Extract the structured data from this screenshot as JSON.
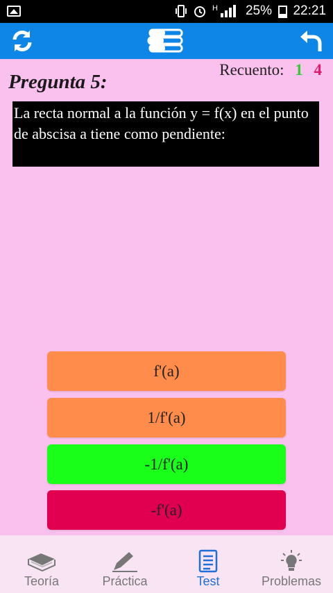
{
  "status_bar": {
    "battery_percent": "25%",
    "time": "22:21",
    "network_type": "H",
    "icons": [
      "image-icon",
      "vibrate-icon",
      "alarm-icon",
      "signal-icon",
      "battery-icon"
    ]
  },
  "toolbar": {
    "background": "#0d86e8",
    "icons": [
      "refresh-icon",
      "books-icon",
      "back-icon"
    ]
  },
  "question": {
    "title": "Pregunta 5:",
    "text": "La recta normal a la función y = f(x) en el punto de abscisa a tiene como pendiente:"
  },
  "score": {
    "label": "Recuento:",
    "correct": "1",
    "wrong": "4",
    "correct_color": "#2ecc2e",
    "wrong_color": "#e01b6a"
  },
  "answers": [
    {
      "label": "f'(a)",
      "color": "#ff8c4a"
    },
    {
      "label": "1/f'(a)",
      "color": "#ff8c4a"
    },
    {
      "label": "-1/f'(a)",
      "color": "#19ff19"
    },
    {
      "label": "-f'(a)",
      "color": "#e0004f"
    }
  ],
  "bottom_nav": {
    "active": "Test",
    "items": [
      {
        "label": "Teoría",
        "icon": "book-icon"
      },
      {
        "label": "Práctica",
        "icon": "pencil-icon"
      },
      {
        "label": "Test",
        "icon": "checklist-icon"
      },
      {
        "label": "Problemas",
        "icon": "lightbulb-icon"
      }
    ]
  }
}
